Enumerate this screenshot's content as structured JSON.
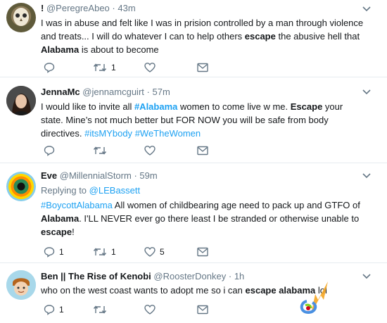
{
  "tweets": [
    {
      "name": "!",
      "handle": "@PeregreAbeo",
      "dot": "·",
      "time": "43m",
      "body": [
        {
          "t": "I was in abuse and felt like I was in prision controlled by a man through violence and treats... I will do whatever I can to help others "
        },
        {
          "t": "escape",
          "b": true
        },
        {
          "t": " the abusive hell that "
        },
        {
          "t": "Alabama",
          "b": true
        },
        {
          "t": " is about to become"
        }
      ],
      "counts": {
        "reply": "",
        "retweet": "1",
        "like": ""
      }
    },
    {
      "name": "JennaMc",
      "handle": "@jennamcguirt",
      "dot": "·",
      "time": "57m",
      "body": [
        {
          "t": "I would like to invite all "
        },
        {
          "t": "#Alabama",
          "h": true,
          "b": true
        },
        {
          "t": " women to come live w me. "
        },
        {
          "t": "Escape",
          "b": true
        },
        {
          "t": " your state. Mine’s not much better but FOR NOW you will be safe from body directives. "
        },
        {
          "t": "#itsMYbody",
          "h": true
        },
        {
          "t": " "
        },
        {
          "t": "#WeTheWomen",
          "h": true
        }
      ],
      "counts": {
        "reply": "",
        "retweet": "",
        "like": ""
      }
    },
    {
      "name": "Eve",
      "handle": "@MillennialStorm",
      "dot": "·",
      "time": "59m",
      "replying_label": "Replying to",
      "replying_to": "@LEBassett",
      "body": [
        {
          "t": "#BoycottAlabama",
          "h": true
        },
        {
          "t": "  All women of childbearing age need to pack up and GTFO of "
        },
        {
          "t": "Alabama",
          "b": true
        },
        {
          "t": ". I'LL NEVER ever go there least I be stranded or otherwise unable to "
        },
        {
          "t": "escape",
          "b": true
        },
        {
          "t": "!"
        }
      ],
      "counts": {
        "reply": "1",
        "retweet": "1",
        "like": "5"
      }
    },
    {
      "name": "Ben || The Rise of Kenobi",
      "handle": "@RoosterDonkey",
      "dot": "·",
      "time": "1h",
      "body": [
        {
          "t": "who on the west coast wants to adopt me so i can "
        },
        {
          "t": "escape alabama",
          "b": true
        },
        {
          "t": " lol"
        }
      ],
      "counts": {
        "reply": "1",
        "retweet": "",
        "like": ""
      }
    }
  ],
  "colors": {
    "accent": "#1da1f2",
    "secondary": "#657786",
    "icon": "#657786"
  }
}
